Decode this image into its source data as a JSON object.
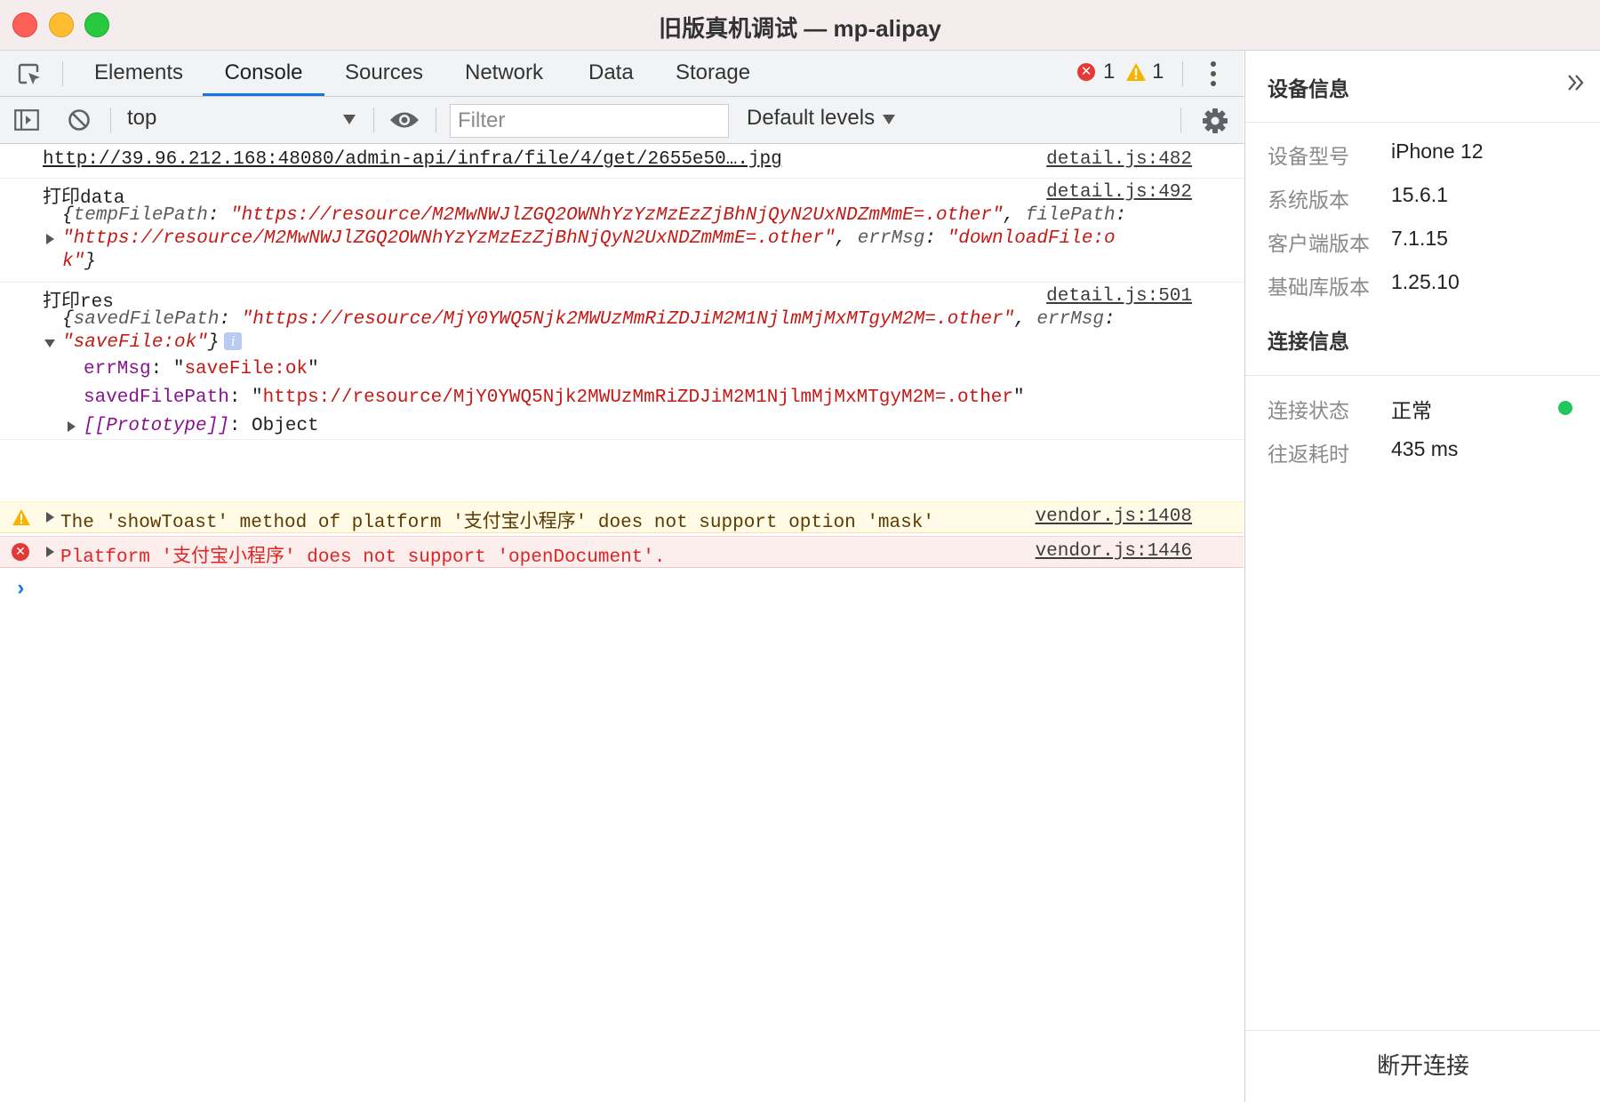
{
  "window": {
    "title": "旧版真机调试 — mp-alipay"
  },
  "tabs": [
    {
      "label": "Elements"
    },
    {
      "label": "Console"
    },
    {
      "label": "Sources"
    },
    {
      "label": "Network"
    },
    {
      "label": "Data"
    },
    {
      "label": "Storage"
    }
  ],
  "counts": {
    "errors": "1",
    "warnings": "1"
  },
  "toolbar": {
    "context": "top",
    "filter_placeholder": "Filter",
    "levels": "Default levels"
  },
  "console": {
    "row1": {
      "url": "http://39.96.212.168:48080/admin-api/infra/file/4/get/2655e50….jpg",
      "source": "detail.js:482"
    },
    "row2": {
      "label": "打印data",
      "source": "detail.js:492",
      "p1": "{",
      "k1": "tempFilePath",
      "c1": ": ",
      "v1": "\"https://resource/M2MwNWJlZGQ2OWNhYzYzMzEzZjBhNjQyN2UxNDZmMmE=.other\"",
      "c2": ", ",
      "k2": "filePath",
      "c3": ":",
      "v2": "\"https://resource/M2MwNWJlZGQ2OWNhYzYzMzEzZjBhNjQyN2UxNDZmMmE=.other\"",
      "c4": ", ",
      "k3": "errMsg",
      "c5": ": ",
      "v3a": "\"downloadFile:o",
      "v3b": "k\"",
      "p2": "}"
    },
    "row3": {
      "label": "打印res",
      "source": "detail.js:501",
      "p1": "{",
      "k1": "savedFilePath",
      "c1": ": ",
      "v1": "\"https://resource/MjY0YWQ5Njk2MWUzMmRiZDJiM2M1NjlmMjMxMTgyM2M=.other\"",
      "c2": ", ",
      "k2": "errMsg",
      "c3": ":",
      "v2": "\"saveFile:ok\"",
      "p2": "}",
      "info": "i",
      "prop1_key": "errMsg",
      "prop1_colon": ": ",
      "prop1_q1": "\"",
      "prop1_val": "saveFile:ok",
      "prop1_q2": "\"",
      "prop2_key": "savedFilePath",
      "prop2_colon": ": ",
      "prop2_q1": "\"",
      "prop2_val": "https://resource/MjY0YWQ5Njk2MWUzMmRiZDJiM2M1NjlmMjMxMTgyM2M=.other",
      "prop2_q2": "\"",
      "proto_key": "[[Prototype]]",
      "proto_colon": ": ",
      "proto_val": "Object"
    },
    "warn": {
      "text": "The 'showToast' method of platform '支付宝小程序' does not support option 'mask'",
      "source": "vendor.js:1408"
    },
    "error": {
      "text": "Platform '支付宝小程序' does not support 'openDocument'.",
      "source": "vendor.js:1446"
    }
  },
  "device": {
    "title": "设备信息",
    "items": [
      {
        "label": "设备型号",
        "value": "iPhone 12"
      },
      {
        "label": "系统版本",
        "value": "15.6.1"
      },
      {
        "label": "客户端版本",
        "value": "7.1.15"
      },
      {
        "label": "基础库版本",
        "value": "1.25.10"
      }
    ]
  },
  "connection": {
    "title": "连接信息",
    "items": [
      {
        "label": "连接状态",
        "value": "正常"
      },
      {
        "label": "往返耗时",
        "value": "435 ms"
      }
    ],
    "status_color": "#22c55e"
  },
  "disconnect_label": "断开连接"
}
